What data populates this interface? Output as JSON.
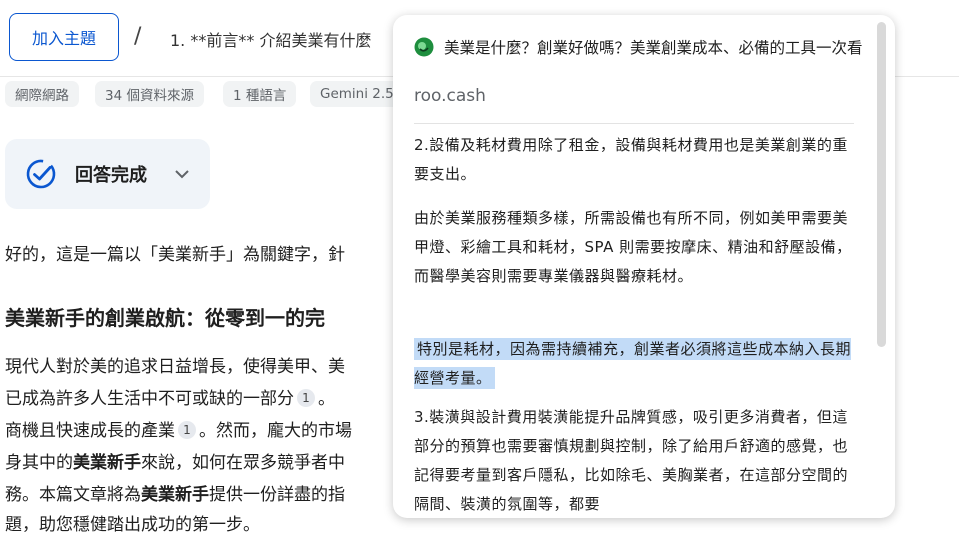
{
  "header": {
    "add_topic_label": "加入主題",
    "separator": "/",
    "breadcrumb": "1. **前言** 介紹美業有什麼"
  },
  "chips": [
    "網際網路",
    "34 個資料來源",
    "1 種語言",
    "Gemini 2.5"
  ],
  "answer_status": {
    "label": "回答完成"
  },
  "article": {
    "intro": "好的，這是一篇以「美業新手」為關鍵字，針",
    "heading": "美業新手的創業啟航：從零到一的完",
    "p1": "現代人對於美的追求日益增長，使得美甲、美",
    "p2a": "已成為許多人生活中不可或缺的一部分",
    "p2b": "。",
    "p3a": "商機且快速成長的產業",
    "p3b": "。然而，龐大的市場",
    "p4a": "身其中的",
    "p4b": "美業新手",
    "p4c": "來說，如何在眾多競爭者中",
    "p5a": "務。本篇文章將為",
    "p5b": "美業新手",
    "p5c": "提供一份詳盡的指",
    "p6": "題，助您穩健踏出成功的第一步。",
    "cite1": "1",
    "cite2": "1"
  },
  "source_popup": {
    "title": "美業是什麼？創業好做嗎？美業創業成本、必備的工具一次看",
    "domain": "roo.cash",
    "para1": "2.設備及耗材費用除了租金，設備與耗材費用也是美業創業的重要支出。",
    "para2": "由於美業服務種類多樣，所需設備也有所不同，例如美甲需要美甲燈、彩繪工具和耗材，SPA 則需要按摩床、精油和舒壓設備，而醫學美容則需要專業儀器與醫療耗材。",
    "highlight": "特別是耗材，因為需持續補充，創業者必須將這些成本納入長期經營考量。",
    "para3": "3.裝潢與設計費用裝潢能提升品牌質感，吸引更多消費者，但這部分的預算也需要審慎規劃與控制，除了給用戶舒適的感覺，也記得要考量到客戶隱私，比如除毛、美胸業者，在這部分空間的隔間、裝潢的氛圍等，都要"
  },
  "colors": {
    "accent": "#0b57d0",
    "highlight": "#c2dbf7",
    "chip_bg": "#f1f3f4",
    "answer_bg": "#f0f4f9"
  }
}
